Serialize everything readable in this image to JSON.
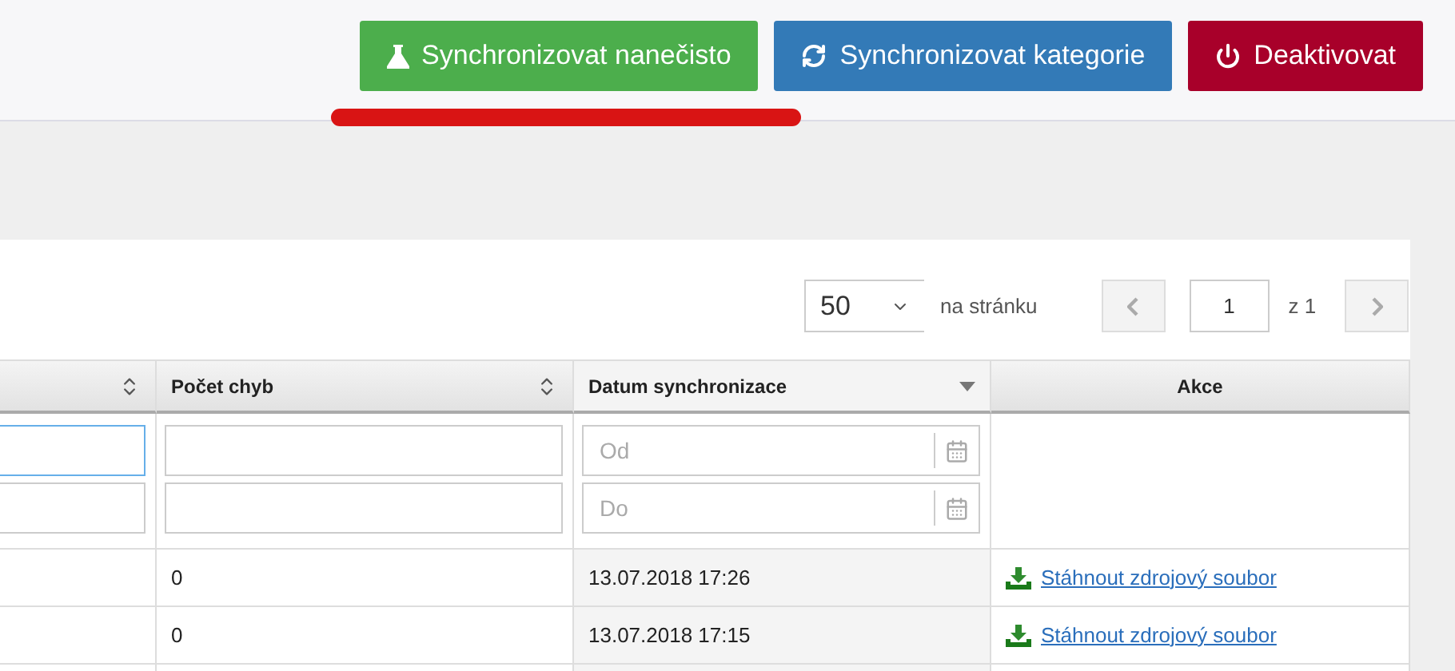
{
  "toolbar": {
    "buttons": [
      {
        "label": "Synchronizovat nanečisto",
        "kind": "flask",
        "color": "#4cae4c",
        "underlined": true
      },
      {
        "label": "Synchronizovat kategorie",
        "kind": "sync",
        "color": "#337ab7",
        "underlined": false
      },
      {
        "label": "Deaktivovat",
        "kind": "power",
        "color": "#a8002a",
        "underlined": false
      }
    ]
  },
  "pagination": {
    "page_size": "50",
    "page_size_label": "na stránku",
    "page": "1",
    "total": "z 1",
    "prev_disabled": true,
    "next_disabled": true
  },
  "table": {
    "columns": [
      {
        "sortable": true,
        "sorted_desc": false,
        "kind": "text",
        "filters": [
          {
            "focused": true
          },
          {
            "focused": false
          }
        ]
      },
      {
        "label": "Počet chyb",
        "sortable": true,
        "sorted_desc": false,
        "kind": "text",
        "filters": [
          {
            "focused": false
          },
          {
            "focused": false
          }
        ]
      },
      {
        "label": "Datum synchronizace",
        "sortable": false,
        "sorted_desc": true,
        "kind": "date",
        "filters": [
          {
            "placeholder": "Od",
            "focused": false
          },
          {
            "placeholder": "Do",
            "focused": false
          }
        ]
      },
      {
        "label": "Akce",
        "sortable": false,
        "sorted_desc": false,
        "kind": "actions"
      }
    ],
    "rows": [
      {
        "cells": [
          "",
          "0",
          "13.07.2018 17:26",
          "Stáhnout zdrojový soubor"
        ]
      },
      {
        "cells": [
          "",
          "0",
          "13.07.2018 17:15",
          "Stáhnout zdrojový soubor"
        ]
      }
    ]
  }
}
